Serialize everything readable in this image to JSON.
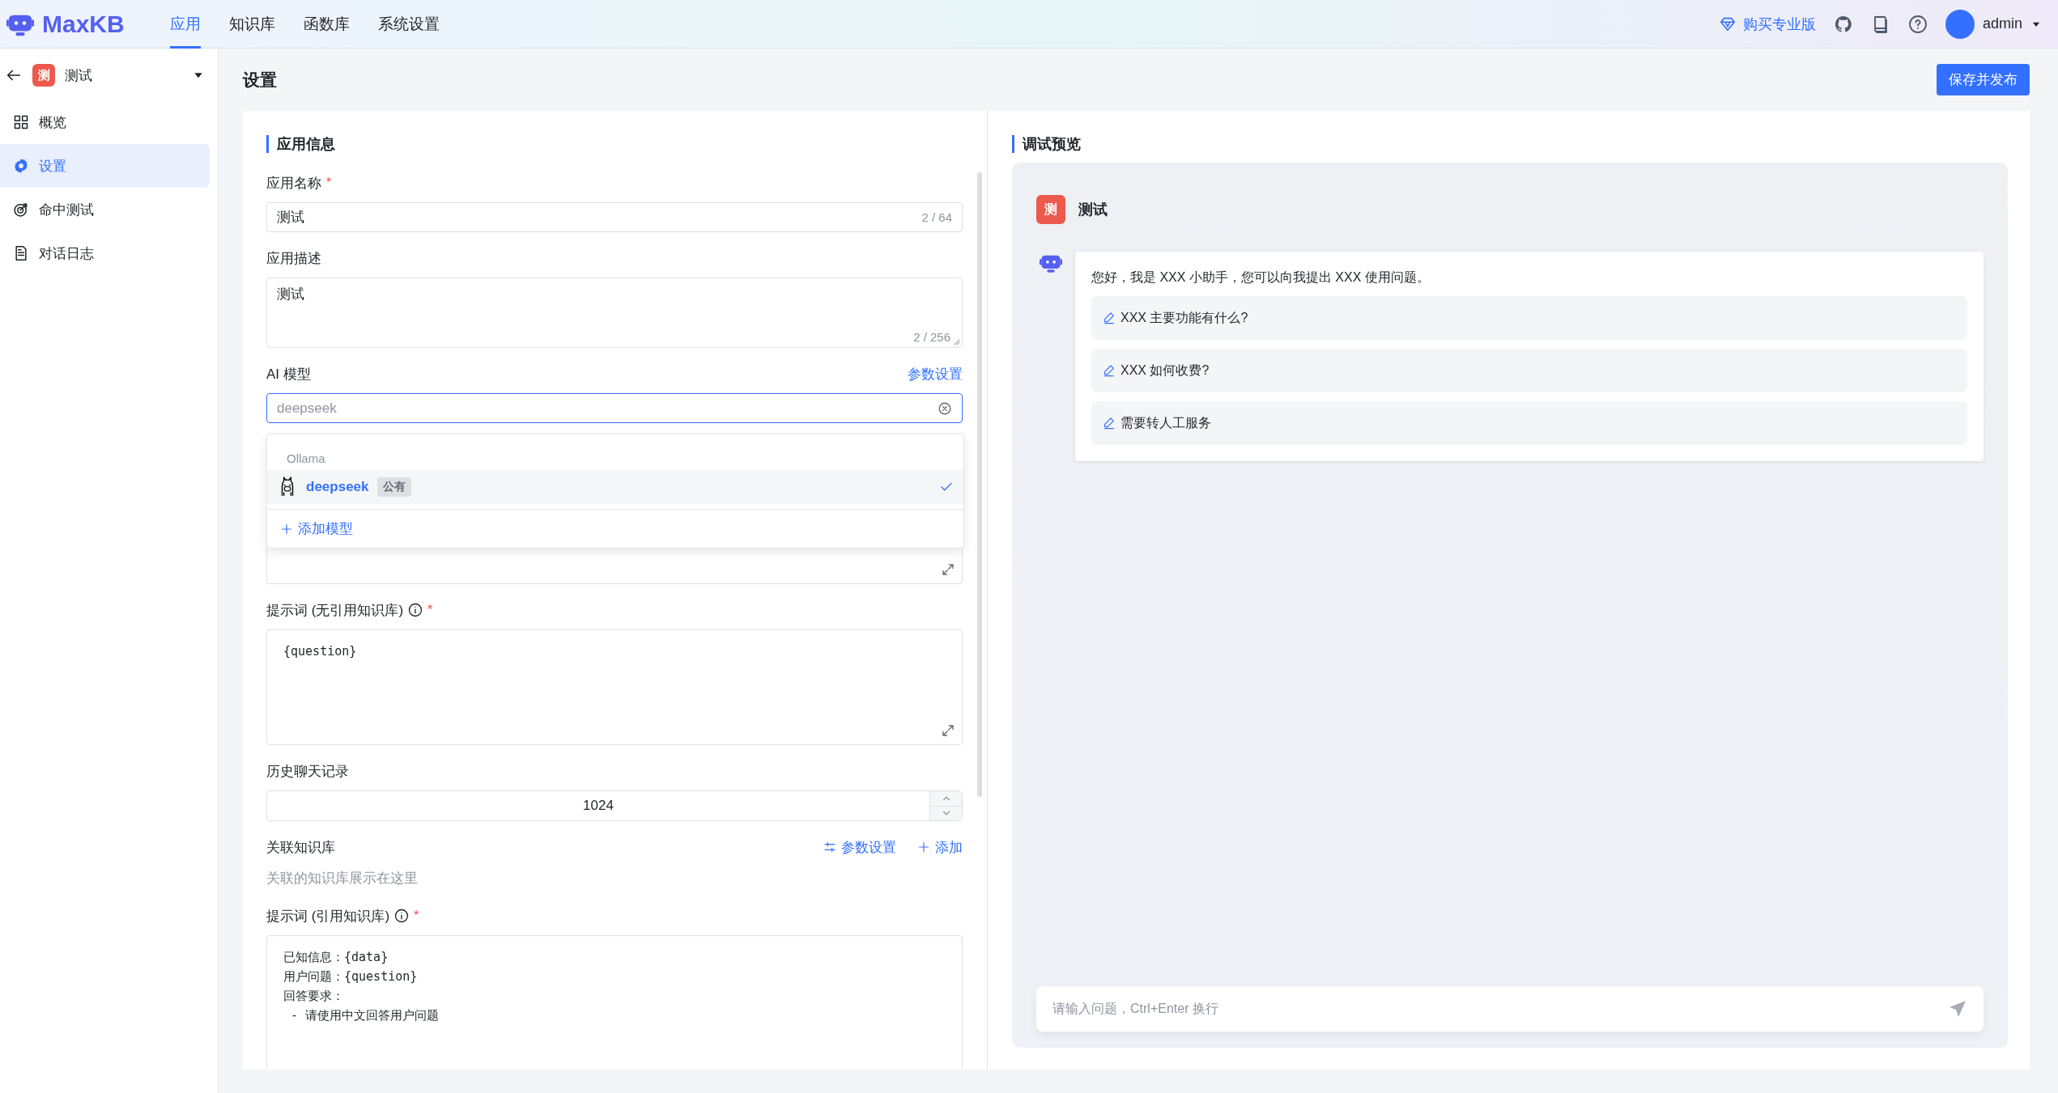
{
  "header": {
    "logo": "MaxKB",
    "nav": [
      {
        "label": "应用",
        "selected": true
      },
      {
        "label": "知识库",
        "selected": false
      },
      {
        "label": "函数库",
        "selected": false
      },
      {
        "label": "系统设置",
        "selected": false
      }
    ],
    "upgrade": "购买专业版",
    "user": "admin"
  },
  "sidebar": {
    "app_avatar": "测",
    "app_name": "测试",
    "items": [
      {
        "label": "概览",
        "selected": false
      },
      {
        "label": "设置",
        "selected": true
      },
      {
        "label": "命中测试",
        "selected": false
      },
      {
        "label": "对话日志",
        "selected": false
      }
    ]
  },
  "page": {
    "title": "设置",
    "save_button": "保存并发布"
  },
  "app_info": {
    "title": "应用信息",
    "fields": [
      {
        "kind": "input",
        "label": "应用名称",
        "required_mark": "*",
        "value": "测试",
        "count": "2 / 64"
      },
      {
        "kind": "textarea",
        "label": "应用描述",
        "value": "测试",
        "count": "2 / 256"
      },
      {
        "kind": "select",
        "label": "AI 模型",
        "link": "参数设置",
        "placeholder": "deepseek",
        "focused": true,
        "dropdown": {
          "group": "Ollama",
          "options": [
            {
              "name": "deepseek",
              "tag": "公有",
              "selected": true
            }
          ],
          "add": "添加模型"
        }
      },
      {
        "kind": "covered"
      },
      {
        "kind": "editor",
        "label": "提示词 (无引用知识库)",
        "info": true,
        "required_mark": "*",
        "value": "{question}"
      },
      {
        "kind": "number",
        "label": "历史聊天记录",
        "value": "1024"
      },
      {
        "kind": "knowledge",
        "label": "关联知识库",
        "actions": [
          "参数设置",
          "添加"
        ],
        "empty": "关联的知识库展示在这里"
      },
      {
        "kind": "editor",
        "label": "提示词 (引用知识库)",
        "info": true,
        "required_mark": "*",
        "value": "已知信息：{data}\n用户问题：{question}\n回答要求：\n - 请使用中文回答用户问题"
      }
    ]
  },
  "preview": {
    "title": "调试预览",
    "app_avatar": "测",
    "app_name": "测试",
    "greeting": "您好，我是 XXX 小助手，您可以向我提出 XXX 使用问题。",
    "suggestions": [
      "XXX 主要功能有什么?",
      "XXX 如何收费?",
      "需要转人工服务"
    ],
    "input_placeholder": "请输入问题，Ctrl+Enter 换行"
  }
}
